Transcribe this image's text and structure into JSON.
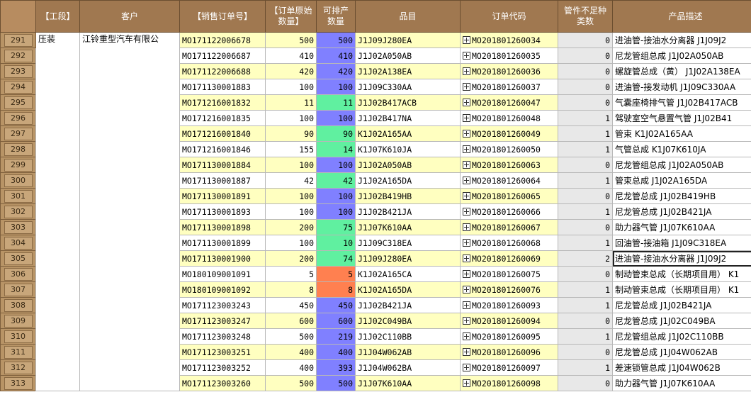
{
  "columns": [
    {
      "key": "row_no",
      "label": ""
    },
    {
      "key": "section",
      "label": "【工段】"
    },
    {
      "key": "customer",
      "label": "客户"
    },
    {
      "key": "sales_order",
      "label": "【销售订单号】"
    },
    {
      "key": "orig_qty",
      "label": "【订单原始\n数量】"
    },
    {
      "key": "schedulable",
      "label": "可排产\n数量"
    },
    {
      "key": "item",
      "label": "品目"
    },
    {
      "key": "order_code",
      "label": "订单代码"
    },
    {
      "key": "shortage",
      "label": "管件不足种\n类数"
    },
    {
      "key": "desc",
      "label": "产品描述"
    }
  ],
  "colors": {
    "header_bg": "#a07850",
    "row_header_bg": "#b89466",
    "yellow": "#ffffc0",
    "white": "#ffffff",
    "blue_qty": "#8080ff",
    "green_qty": "#60f0a0",
    "orange_qty": "#ff8050",
    "gray": "#e8e8e8"
  },
  "section_value": "压装",
  "customer_value": "江铃重型汽车有限公",
  "rows": [
    {
      "n": "291",
      "so": "MO171122006678",
      "orig": "500",
      "sched": "500",
      "item": "J1J09J280EA",
      "code": "MO201801260034",
      "short": "0",
      "desc": "进油管-接油水分离器  J1J09J2",
      "tone": "yellow",
      "qty_color": "blue"
    },
    {
      "n": "292",
      "so": "MO171122006687",
      "orig": "410",
      "sched": "410",
      "item": "J1J02A050AB",
      "code": "MO201801260035",
      "short": "0",
      "desc": "尼龙管组总成 J1J02A050AB",
      "tone": "white",
      "qty_color": "blue"
    },
    {
      "n": "293",
      "so": "MO171122006688",
      "orig": "420",
      "sched": "420",
      "item": "J1J02A138EA",
      "code": "MO201801260036",
      "short": "0",
      "desc": "螺旋管总成（黄） J1J02A138EA",
      "tone": "yellow",
      "qty_color": "blue"
    },
    {
      "n": "294",
      "so": "MO171130001883",
      "orig": "100",
      "sched": "100",
      "item": "J1J09C330AA",
      "code": "MO201801260037",
      "short": "0",
      "desc": "进油管-接发动机  J1J09C330AA",
      "tone": "white",
      "qty_color": "blue"
    },
    {
      "n": "295",
      "so": "MO171216001832",
      "orig": "11",
      "sched": "11",
      "item": "J1J02B417ACB",
      "code": "MO201801260047",
      "short": "0",
      "desc": "气囊座椅排气管 J1J02B417ACB",
      "tone": "yellow",
      "qty_color": "green"
    },
    {
      "n": "296",
      "so": "MO171216001835",
      "orig": "100",
      "sched": "100",
      "item": "J1J02B417NA",
      "code": "MO201801260048",
      "short": "1",
      "desc": "驾驶室空气悬置气管  J1J02B41",
      "tone": "white",
      "qty_color": "blue"
    },
    {
      "n": "297",
      "so": "MO171216001840",
      "orig": "90",
      "sched": "90",
      "item": "K1J02A165AA",
      "code": "MO201801260049",
      "short": "1",
      "desc": "管束    K1J02A165AA",
      "tone": "yellow",
      "qty_color": "green"
    },
    {
      "n": "298",
      "so": "MO171216001846",
      "orig": "155",
      "sched": "14",
      "item": "K1J07K610JA",
      "code": "MO201801260050",
      "short": "1",
      "desc": "气管总成 K1J07K610JA",
      "tone": "white",
      "qty_color": "green"
    },
    {
      "n": "299",
      "so": "MO171130001884",
      "orig": "100",
      "sched": "100",
      "item": "J1J02A050AB",
      "code": "MO201801260063",
      "short": "0",
      "desc": "尼龙管组总成 J1J02A050AB",
      "tone": "yellow",
      "qty_color": "blue"
    },
    {
      "n": "300",
      "so": "MO171130001887",
      "orig": "42",
      "sched": "42",
      "item": "J1J02A165DA",
      "code": "MO201801260064",
      "short": "1",
      "desc": "管束总成 J1J02A165DA",
      "tone": "white",
      "qty_color": "green"
    },
    {
      "n": "301",
      "so": "MO171130001891",
      "orig": "100",
      "sched": "100",
      "item": "J1J02B419HB",
      "code": "MO201801260065",
      "short": "0",
      "desc": "尼龙管总成     J1J02B419HB",
      "tone": "yellow",
      "qty_color": "blue"
    },
    {
      "n": "302",
      "so": "MO171130001893",
      "orig": "100",
      "sched": "100",
      "item": "J1J02B421JA",
      "code": "MO201801260066",
      "short": "1",
      "desc": "尼龙管总成     J1J02B421JA",
      "tone": "white",
      "qty_color": "blue"
    },
    {
      "n": "303",
      "so": "MO171130001898",
      "orig": "200",
      "sched": "75",
      "item": "J1J07K610AA",
      "code": "MO201801260067",
      "short": "0",
      "desc": "助力器气管     J1J07K610AA",
      "tone": "yellow",
      "qty_color": "green"
    },
    {
      "n": "304",
      "so": "MO171130001899",
      "orig": "100",
      "sched": "10",
      "item": "J1J09C318EA",
      "code": "MO201801260068",
      "short": "1",
      "desc": "回油管-接油箱    J1J09C318EA",
      "tone": "white",
      "qty_color": "green"
    },
    {
      "n": "305",
      "so": "MO171130001900",
      "orig": "200",
      "sched": "74",
      "item": "J1J09J280EA",
      "code": "MO201801260069",
      "short": "2",
      "desc": "进油管-接油水分离器  J1J09J2",
      "tone": "yellow",
      "qty_color": "green",
      "selected": true
    },
    {
      "n": "306",
      "so": "MO180109001091",
      "orig": "5",
      "sched": "5",
      "item": "K1J02A165CA",
      "code": "MO201801260075",
      "short": "0",
      "desc": "制动管束总成（长期项目用）  K1",
      "tone": "white",
      "qty_color": "orange"
    },
    {
      "n": "307",
      "so": "MO180109001092",
      "orig": "8",
      "sched": "8",
      "item": "K1J02A165DA",
      "code": "MO201801260076",
      "short": "1",
      "desc": "制动管束总成（长期项目用）  K1",
      "tone": "yellow",
      "qty_color": "orange"
    },
    {
      "n": "308",
      "so": "MO171123003243",
      "orig": "450",
      "sched": "450",
      "item": "J1J02B421JA",
      "code": "MO201801260093",
      "short": "1",
      "desc": "尼龙管总成     J1J02B421JA",
      "tone": "white",
      "qty_color": "blue"
    },
    {
      "n": "309",
      "so": "MO171123003247",
      "orig": "600",
      "sched": "600",
      "item": "J1J02C049BA",
      "code": "MO201801260094",
      "short": "0",
      "desc": "尼龙管总成     J1J02C049BA",
      "tone": "yellow",
      "qty_color": "blue"
    },
    {
      "n": "310",
      "so": "MO171123003248",
      "orig": "500",
      "sched": "219",
      "item": "J1J02C110BB",
      "code": "MO201801260095",
      "short": "1",
      "desc": "尼龙管组总成 J1J02C110BB",
      "tone": "white",
      "qty_color": "blue"
    },
    {
      "n": "311",
      "so": "MO171123003251",
      "orig": "400",
      "sched": "400",
      "item": "J1J04W062AB",
      "code": "MO201801260096",
      "short": "0",
      "desc": "尼龙管总成 J1J04W062AB",
      "tone": "yellow",
      "qty_color": "blue"
    },
    {
      "n": "312",
      "so": "MO171123003252",
      "orig": "400",
      "sched": "393",
      "item": "J1J04W062BA",
      "code": "MO201801260097",
      "short": "1",
      "desc": "差速锁管总成        J1J04W062B",
      "tone": "white",
      "qty_color": "blue"
    },
    {
      "n": "313",
      "so": "MO171123003260",
      "orig": "500",
      "sched": "500",
      "item": "J1J07K610AA",
      "code": "MO201801260098",
      "short": "0",
      "desc": "助力器气管     J1J07K610AA",
      "tone": "yellow",
      "qty_color": "blue"
    }
  ]
}
